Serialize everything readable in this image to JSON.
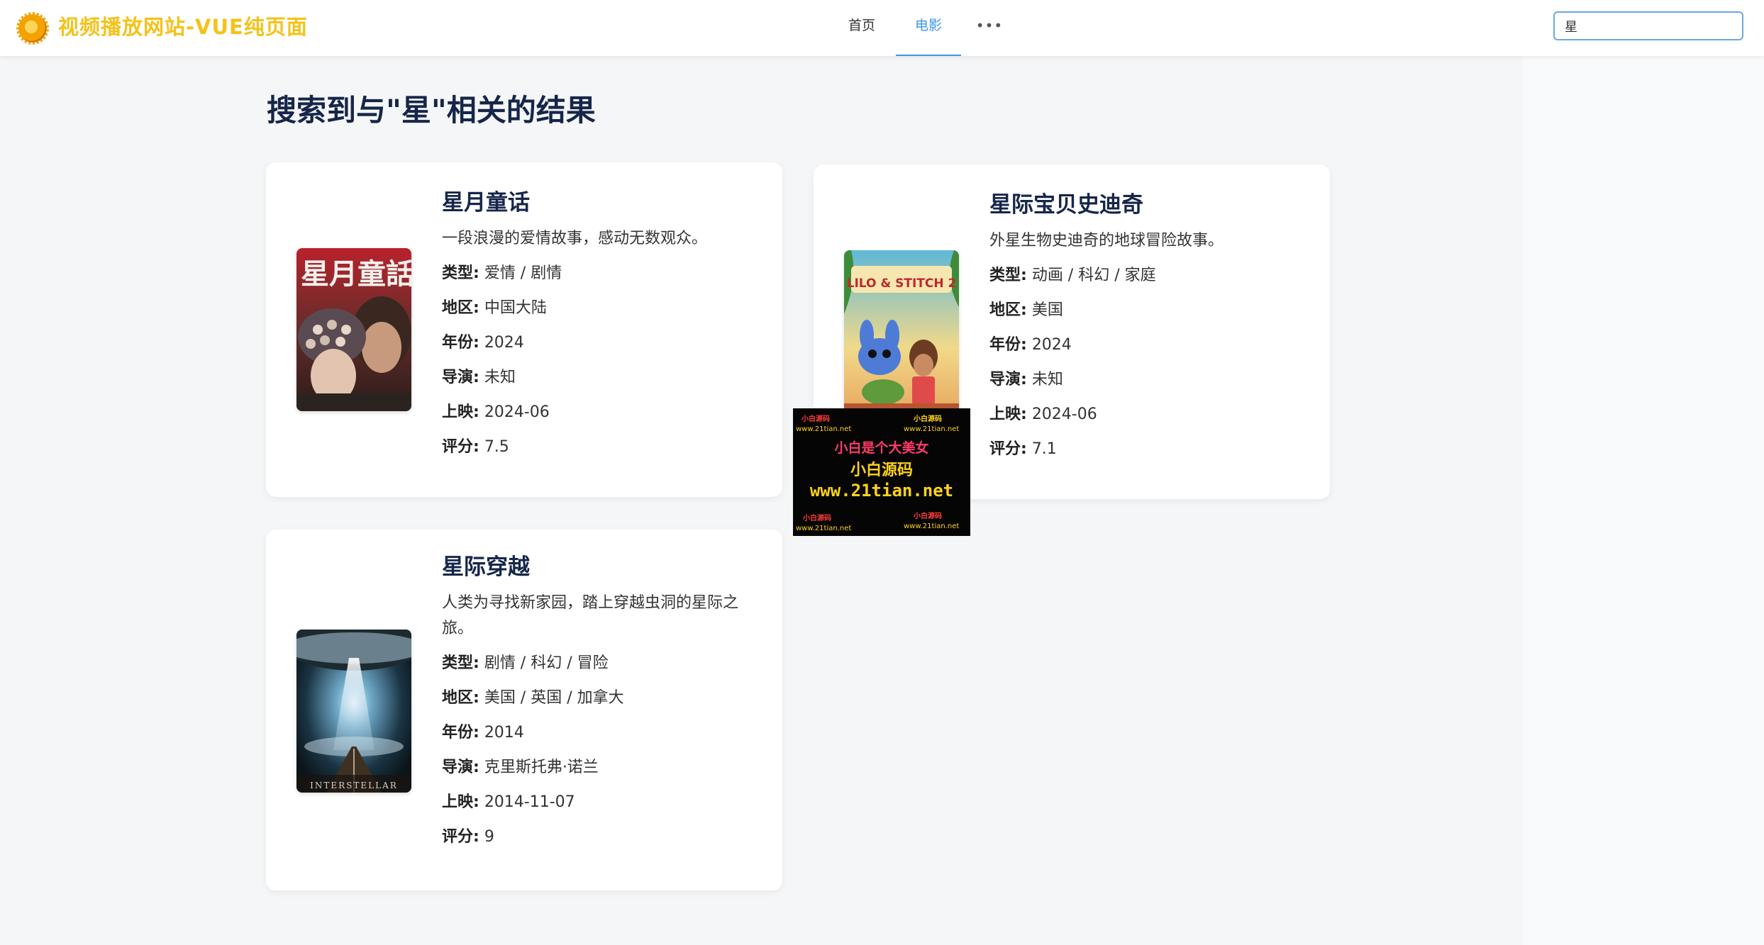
{
  "header": {
    "site_title": "视频播放网站-VUE纯页面",
    "nav": [
      {
        "label": "首页"
      },
      {
        "label": "电影"
      },
      {
        "label": "•••"
      }
    ],
    "search": {
      "value": "星"
    }
  },
  "main": {
    "title": "搜索到与\"星\"相关的结果",
    "labels": {
      "genre": "类型:",
      "region": "地区:",
      "year": "年份:",
      "director": "导演:",
      "release": "上映:",
      "rating": "评分:"
    },
    "movies": [
      {
        "title": "星月童话",
        "poster_text": "星月童話",
        "desc": "一段浪漫的爱情故事，感动无数观众。",
        "genre": "爱情 / 剧情",
        "region": "中国大陆",
        "year": "2024",
        "director": "未知",
        "release": "2024-06",
        "rating": "7.5"
      },
      {
        "title": "星际宝贝史迪奇",
        "poster_text": "LILO & STITCH 2",
        "desc": "外星生物史迪奇的地球冒险故事。",
        "genre": "动画 / 科幻 / 家庭",
        "region": "美国",
        "year": "2024",
        "director": "未知",
        "release": "2024-06",
        "rating": "7.1"
      },
      {
        "title": "星际穿越",
        "poster_text": "INTERSTELLAR",
        "desc": "人类为寻找新家园，踏上穿越虫洞的星际之旅。",
        "genre": "剧情 / 科幻 / 冒险",
        "region": "美国 / 英国 / 加拿大",
        "year": "2014",
        "director": "克里斯托弗·诺兰",
        "release": "2014-11-07",
        "rating": "9"
      }
    ]
  },
  "watermark": {
    "small_tl": "小白源码",
    "small_tl2": "www.21tian.net",
    "small_tr": "小白源码",
    "small_tr2": "www.21tian.net",
    "line1": "小白是个大美女",
    "line2": "小白源码",
    "line3": "www.21tian.net",
    "small_bl": "小白源码",
    "small_bl2": "www.21tian.net",
    "small_br": "小白源码",
    "small_br2": "www.21tian.net"
  }
}
